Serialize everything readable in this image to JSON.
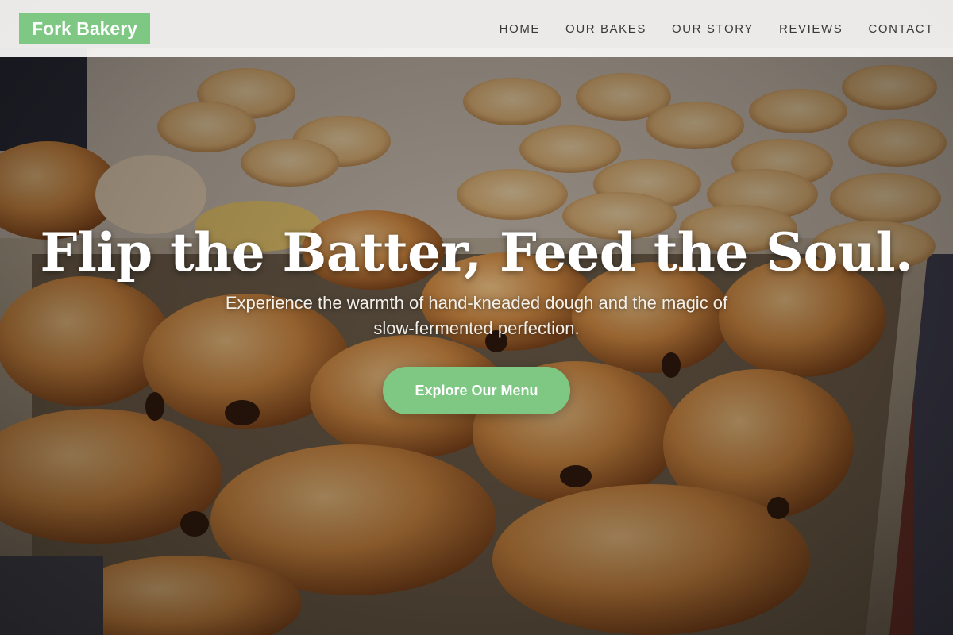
{
  "brand": {
    "name": "Fork Bakery",
    "color": "#7ec884"
  },
  "nav": {
    "items": [
      {
        "label": "HOME"
      },
      {
        "label": "OUR BAKES"
      },
      {
        "label": "OUR STORY"
      },
      {
        "label": "REVIEWS"
      },
      {
        "label": "CONTACT"
      }
    ]
  },
  "hero": {
    "headline": "Flip the Batter, Feed the Soul.",
    "subtitle": "Experience the warmth of hand-kneaded dough and the magic of slow-fermented perfection.",
    "cta_label": "Explore Our Menu",
    "background": "photo of pastries on a bakery tray"
  },
  "colors": {
    "accent": "#7ec884",
    "nav_background": "#faf9f7",
    "nav_text": "#3a3a3a",
    "hero_text": "#ffffff"
  }
}
